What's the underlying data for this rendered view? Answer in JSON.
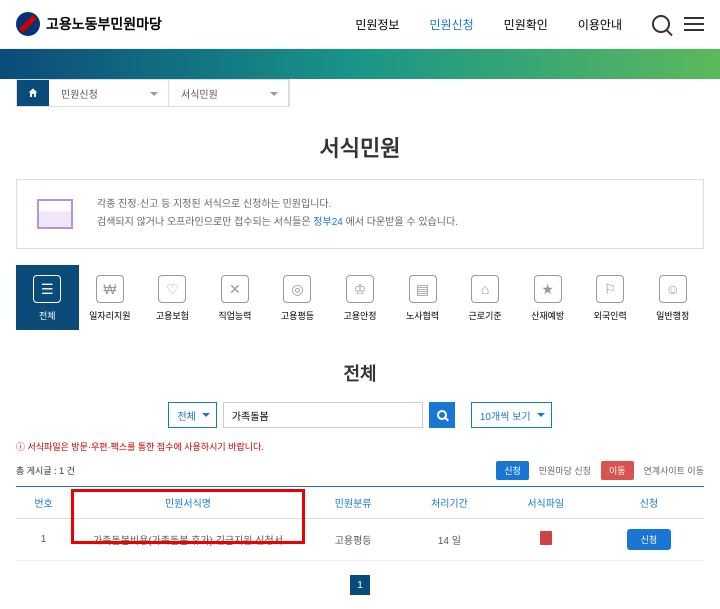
{
  "header": {
    "logo_text": "고용노동부민원마당",
    "nav": [
      "민원정보",
      "민원신청",
      "민원확인",
      "이용안내"
    ],
    "nav_active": 1
  },
  "breadcrumb": {
    "items": [
      "민원신청",
      "서식민원"
    ]
  },
  "page_title": "서식민원",
  "info": {
    "line1": "각종 진정·신고 등 지정된 서식으로 신청하는 민원입니다.",
    "line2_pre": "검색되지 않거나 오프라인으로만 접수되는 서식들은 ",
    "line2_link": "정부24",
    "line2_post": " 에서 다운받을 수 있습니다."
  },
  "categories": [
    {
      "label": "전체",
      "glyph": "☰"
    },
    {
      "label": "일자리지원",
      "glyph": "₩"
    },
    {
      "label": "고용보험",
      "glyph": "♡"
    },
    {
      "label": "직업능력",
      "glyph": "✕"
    },
    {
      "label": "고용평등",
      "glyph": "◎"
    },
    {
      "label": "고용안정",
      "glyph": "♔"
    },
    {
      "label": "노사협력",
      "glyph": "▤"
    },
    {
      "label": "근로기준",
      "glyph": "⌂"
    },
    {
      "label": "산재예방",
      "glyph": "★"
    },
    {
      "label": "외국인력",
      "glyph": "⚐"
    },
    {
      "label": "일반행정",
      "glyph": "☺"
    }
  ],
  "section_title": "전체",
  "search": {
    "filter": "전체",
    "query": "가족돌봄",
    "per_page": "10개씩 보기"
  },
  "notice": "ⓘ 서식파일은 방문·우편·팩스를 통한 접수에 사용하시기 바랍니다.",
  "count_text": "총 게시글 : 1 건",
  "legend": {
    "badge1": "신청",
    "text1": "민원마당 신청",
    "badge2": "이동",
    "text2": "연계사이트 이동"
  },
  "table": {
    "headers": [
      "번호",
      "민원서식명",
      "민원분류",
      "처리기간",
      "서식파일",
      "신청"
    ],
    "rows": [
      {
        "no": "1",
        "name": "가족돌봄비용(가족돌봄 휴가) 긴급지원 신청서",
        "cat": "고용평등",
        "period": "14 일",
        "action": "신청"
      }
    ]
  },
  "pager": {
    "current": "1"
  }
}
